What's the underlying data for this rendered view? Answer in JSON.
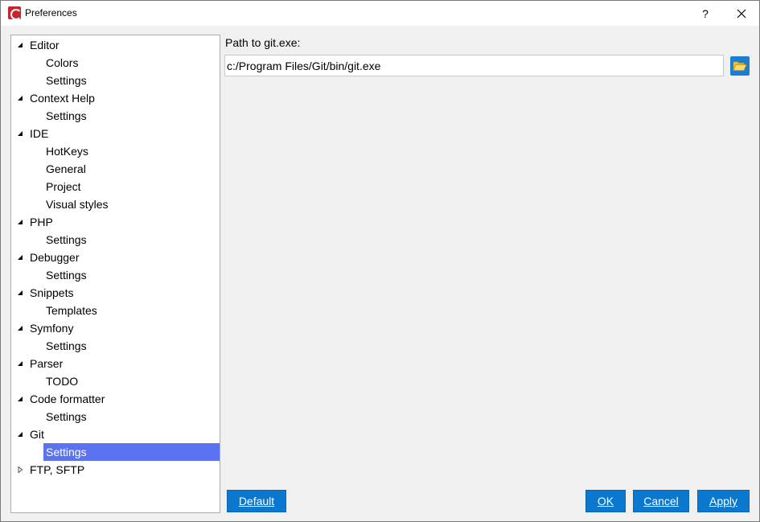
{
  "window": {
    "title": "Preferences",
    "help_label": "?"
  },
  "tree": {
    "items": [
      {
        "label": "Editor",
        "level": 0,
        "expanded": true
      },
      {
        "label": "Colors",
        "level": 1
      },
      {
        "label": "Settings",
        "level": 1
      },
      {
        "label": "Context Help",
        "level": 0,
        "expanded": true
      },
      {
        "label": "Settings",
        "level": 1
      },
      {
        "label": "IDE",
        "level": 0,
        "expanded": true
      },
      {
        "label": "HotKeys",
        "level": 1
      },
      {
        "label": "General",
        "level": 1
      },
      {
        "label": "Project",
        "level": 1
      },
      {
        "label": "Visual styles",
        "level": 1
      },
      {
        "label": "PHP",
        "level": 0,
        "expanded": true
      },
      {
        "label": "Settings",
        "level": 1
      },
      {
        "label": "Debugger",
        "level": 0,
        "expanded": true
      },
      {
        "label": "Settings",
        "level": 1
      },
      {
        "label": "Snippets",
        "level": 0,
        "expanded": true
      },
      {
        "label": "Templates",
        "level": 1
      },
      {
        "label": "Symfony",
        "level": 0,
        "expanded": true
      },
      {
        "label": "Settings",
        "level": 1
      },
      {
        "label": "Parser",
        "level": 0,
        "expanded": true
      },
      {
        "label": "TODO",
        "level": 1
      },
      {
        "label": "Code formatter",
        "level": 0,
        "expanded": true
      },
      {
        "label": "Settings",
        "level": 1
      },
      {
        "label": "Git",
        "level": 0,
        "expanded": true
      },
      {
        "label": "Settings",
        "level": 1,
        "selected": true
      },
      {
        "label": "FTP, SFTP",
        "level": 0,
        "expanded": false
      }
    ]
  },
  "git_settings": {
    "path_label": "Path to git.exe:",
    "path_value": "c:/Program Files/Git/bin/git.exe"
  },
  "buttons": {
    "default_label": "Default",
    "ok_label": "OK",
    "cancel_label": "Cancel",
    "apply_label": "Apply"
  },
  "colors": {
    "selection": "#5b73f0",
    "button": "#0b78d0",
    "folder_icon": "#f5c542"
  }
}
